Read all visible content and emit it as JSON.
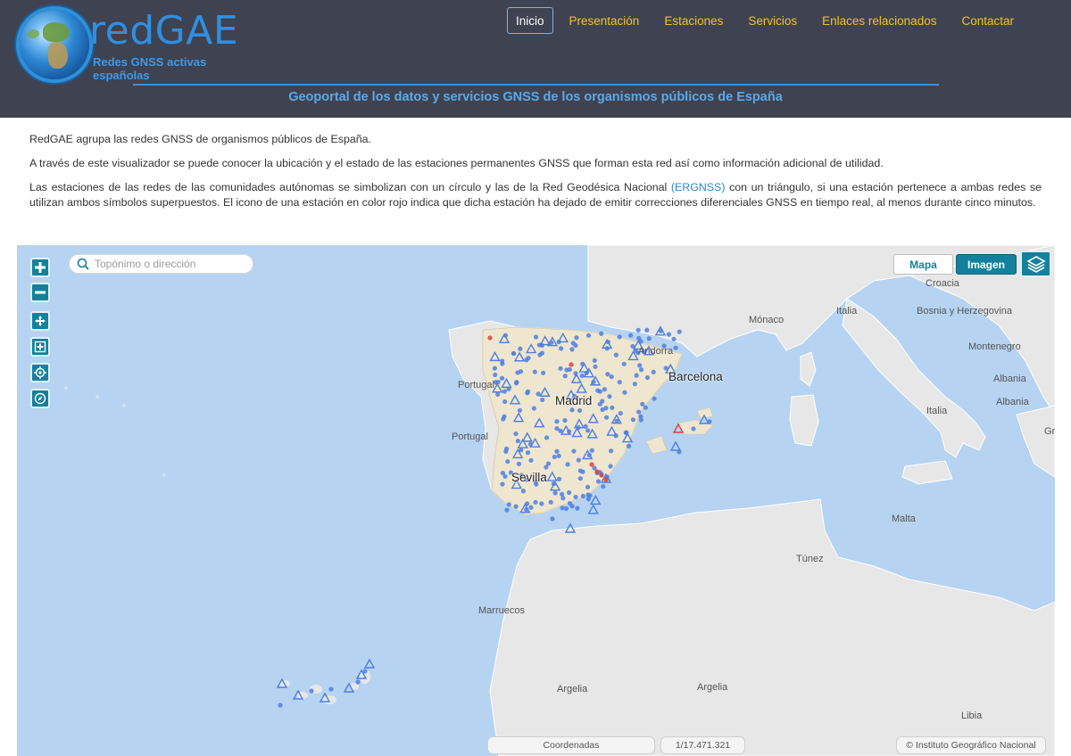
{
  "header": {
    "logo_title": "redGAE",
    "logo_subtitle": "Redes GNSS activas españolas",
    "tagline": "Geoportal de los datos y servicios GNSS de los organismos públicos de España",
    "nav": [
      "Inicio",
      "Presentación",
      "Estaciones",
      "Servicios",
      "Enlaces relacionados",
      "Contactar"
    ],
    "nav_active": "Inicio"
  },
  "intro": {
    "p1": "RedGAE agrupa las redes GNSS de organismos públicos de España.",
    "p2": "A través de este visualizador se puede conocer la ubicación y el estado de las estaciones permanentes GNSS que forman esta red así como información adicional de utilidad.",
    "p3_a": "Las estaciones de las redes de las comunidades autónomas se simbolizan con un círculo y las de la Red Geodésica Nacional ",
    "p3_link": "(ERGNSS)",
    "p3_b": " con un triángulo, si una estación pertenece a ambas redes se utilizan ambos símbolos superpuestos. El icono de una estación en color rojo indica que dicha estación ha dejado de emitir correcciones diferenciales GNSS en tiempo real, al menos durante cinco minutos."
  },
  "map": {
    "search_placeholder": "Topónimo o dirección",
    "btn_mapa": "Mapa",
    "btn_imagen": "Imagen",
    "coords_label": "Coordenadas",
    "scale_label": "1/17.471.321",
    "attribution": "© Instituto Geográfico Nacional",
    "labels": {
      "croacia": "Croacia",
      "italia1": "Italia",
      "monaco": "Mónaco",
      "bosnia": "Bosnia y Herzegovina",
      "andorra": "Andorra",
      "montenegro": "Montenegro",
      "barcelona": "Barcelona",
      "portugal1": "Portugal",
      "albania1": "Albania",
      "madrid": "Madrid",
      "albania2": "Albania",
      "italia2": "Italia",
      "portugal2": "Portugal",
      "gr": "Gr",
      "sevilla": "Sevilla",
      "malta": "Malta",
      "tunez": "Túnez",
      "marruecos": "Marruecos",
      "argelia1": "Argelia",
      "argelia2": "Argelia",
      "libia": "Libia"
    },
    "colors": {
      "sea": "#b6d3f2",
      "land": "#e7e7e7",
      "spain": "#efe6cf",
      "station_ok": "#4d7fe0",
      "station_down": "#e0403a"
    }
  }
}
